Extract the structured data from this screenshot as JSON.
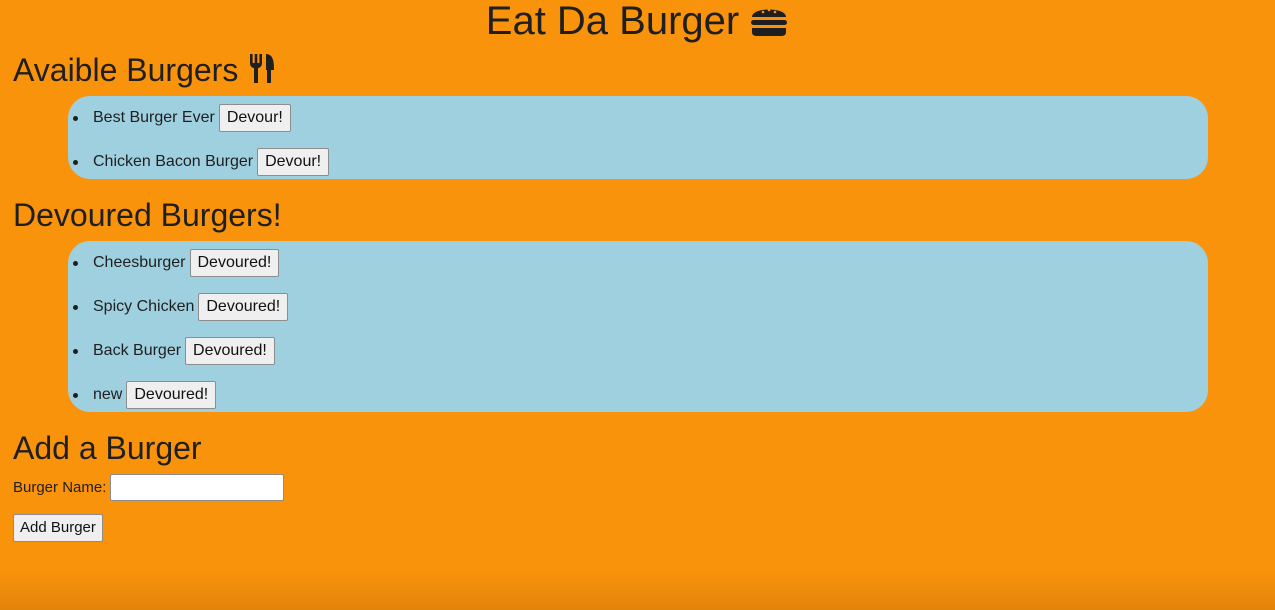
{
  "page": {
    "title": "Eat Da Burger",
    "title_icon": "hamburger-icon",
    "background_color": "#f9930c",
    "panel_color": "#9fd0df"
  },
  "available": {
    "heading": "Avaible Burgers",
    "heading_icon": "utensils-icon",
    "items": [
      {
        "name": "Best Burger Ever",
        "button": "Devour!"
      },
      {
        "name": "Chicken Bacon Burger",
        "button": "Devour!"
      }
    ]
  },
  "devoured": {
    "heading": "Devoured Burgers!",
    "items": [
      {
        "name": "Cheesburger",
        "button": "Devoured!"
      },
      {
        "name": "Spicy Chicken",
        "button": "Devoured!"
      },
      {
        "name": "Back Burger",
        "button": "Devoured!"
      },
      {
        "name": "new",
        "button": "Devoured!"
      }
    ]
  },
  "add_form": {
    "heading": "Add a Burger",
    "label": "Burger Name:",
    "input_value": "",
    "submit_label": "Add Burger"
  }
}
